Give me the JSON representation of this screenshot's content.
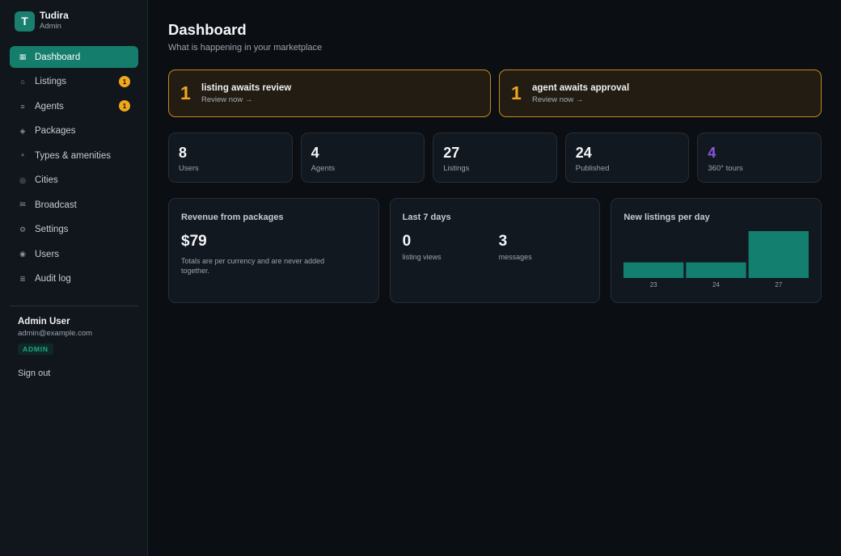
{
  "brand": {
    "logo_letter": "T",
    "name": "Tudira",
    "role": "Admin"
  },
  "nav": [
    {
      "icon": "dashboard-icon",
      "glyph": "▦",
      "label": "Dashboard",
      "active": true
    },
    {
      "icon": "home-icon",
      "glyph": "⌂",
      "label": "Listings",
      "badge": "1"
    },
    {
      "icon": "list-icon",
      "glyph": "≡",
      "label": "Agents",
      "badge": "1"
    },
    {
      "icon": "diamond-icon",
      "glyph": "◈",
      "label": "Packages"
    },
    {
      "icon": "tag-icon",
      "glyph": "⚬",
      "label": "Types & amenities"
    },
    {
      "icon": "city-icon",
      "glyph": "◎",
      "label": "Cities"
    },
    {
      "icon": "mail-icon",
      "glyph": "✉",
      "label": "Broadcast"
    },
    {
      "icon": "gear-icon",
      "glyph": "⚙",
      "label": "Settings"
    },
    {
      "icon": "user-icon",
      "glyph": "◉",
      "label": "Users"
    },
    {
      "icon": "log-icon",
      "glyph": "≣",
      "label": "Audit log"
    }
  ],
  "user": {
    "name": "Admin User",
    "email": "admin@example.com",
    "role": "ADMIN",
    "signout": "Sign out"
  },
  "page": {
    "title": "Dashboard",
    "subtitle": "What is happening in your marketplace"
  },
  "alerts": [
    {
      "count": "1",
      "title": "listing awaits review",
      "link": "Review now →"
    },
    {
      "count": "1",
      "title": "agent awaits approval",
      "link": "Review now →"
    }
  ],
  "stats": [
    {
      "value": "8",
      "label": "Users"
    },
    {
      "value": "4",
      "label": "Agents"
    },
    {
      "value": "27",
      "label": "Listings"
    },
    {
      "value": "24",
      "label": "Published"
    },
    {
      "value": "4",
      "label": "360° tours",
      "highlight": "#8b55e0"
    }
  ],
  "revenue": {
    "title": "Revenue from packages",
    "value": "$79",
    "note": "Totals are per currency and are never added together."
  },
  "last7": {
    "title": "Last 7 days",
    "kpis": [
      {
        "value": "0",
        "label": "listing views"
      },
      {
        "value": "3",
        "label": "messages"
      }
    ]
  },
  "new_listings": {
    "title": "New listings per day"
  },
  "colors": {
    "accent": "#157d6b",
    "warning": "#f0a524",
    "bar": "#13806f"
  },
  "chart_data": {
    "type": "bar",
    "title": "New listings per day",
    "categories": [
      "23",
      "24",
      "27"
    ],
    "values": [
      1,
      1,
      3
    ],
    "xlabel": "",
    "ylabel": "",
    "grid": false
  }
}
